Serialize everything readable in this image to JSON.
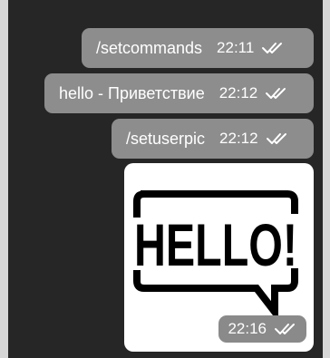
{
  "messages": [
    {
      "text": "/setcommands",
      "time": "22:11",
      "status": "read"
    },
    {
      "text": "hello - Приветствие",
      "time": "22:12",
      "status": "read"
    },
    {
      "text": "/setuserpic",
      "time": "22:12",
      "status": "read"
    }
  ],
  "photo_message": {
    "image_text": "HELLO!",
    "time": "22:16",
    "status": "read"
  },
  "colors": {
    "chat_background": "#262626",
    "bubble": "#8d8d8d",
    "page_background": "#d6d6d6"
  },
  "icons": {
    "read_status": "double-check-icon"
  }
}
